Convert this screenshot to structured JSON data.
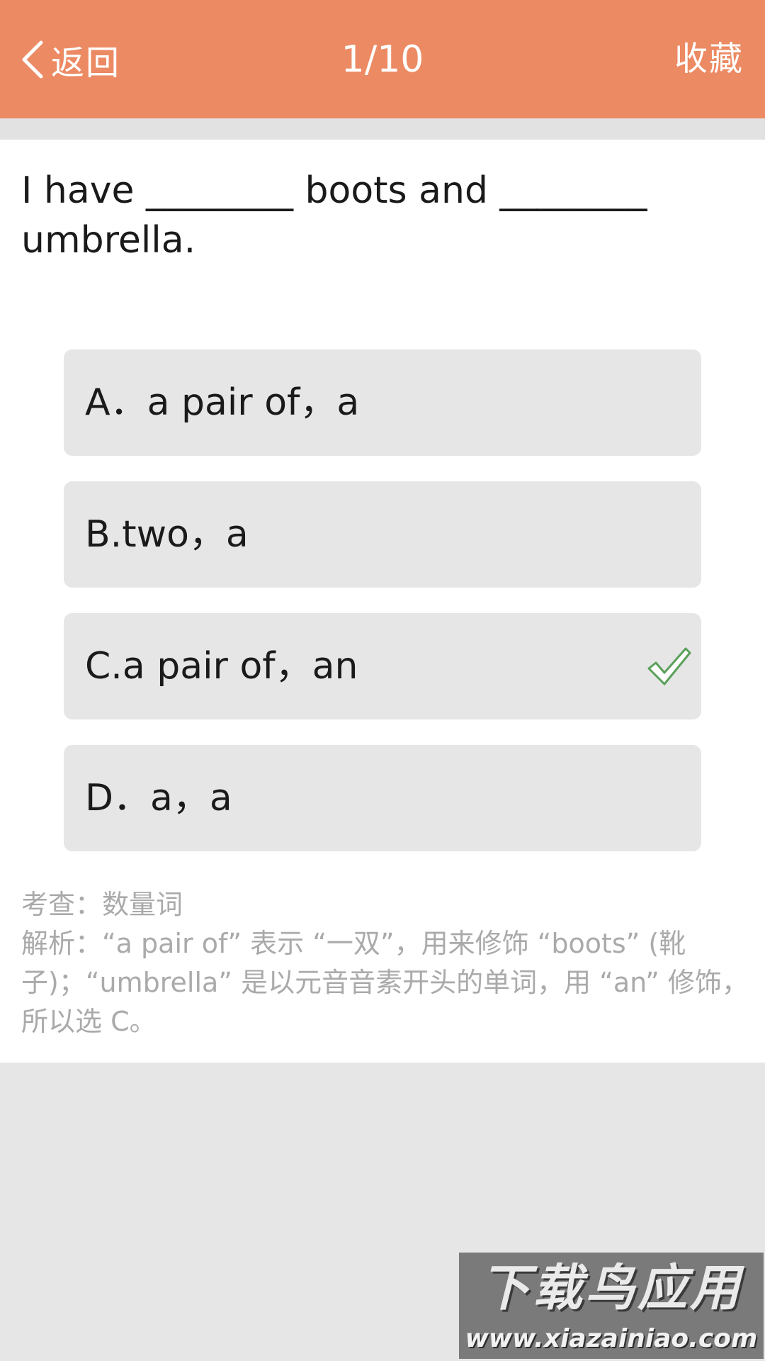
{
  "header": {
    "back_label": "返回",
    "counter": "1/10",
    "favorite_label": "收藏",
    "background": "#ec8a63"
  },
  "question": {
    "text": "I have ________ boots and ________ umbrella."
  },
  "options": [
    {
      "label": "A．a pair of，a",
      "correct": false
    },
    {
      "label": "B.two，a",
      "correct": false
    },
    {
      "label": "C.a pair of，an",
      "correct": true
    },
    {
      "label": "D．a，a",
      "correct": false
    }
  ],
  "explanation": {
    "topic": "考查：数量词",
    "analysis": "解析：“a pair of” 表示 “一双”，用来修饰 “boots” (靴子)；“umbrella” 是以元音音素开头的单词，用 “an” 修饰，所以选 C。"
  },
  "watermark": {
    "title": "下载鸟应用",
    "url": "www.xiazainiao.com"
  },
  "colors": {
    "correct_check": "#5aa05a",
    "option_bg": "#e6e6e6",
    "muted_text": "#aaaaaa"
  }
}
